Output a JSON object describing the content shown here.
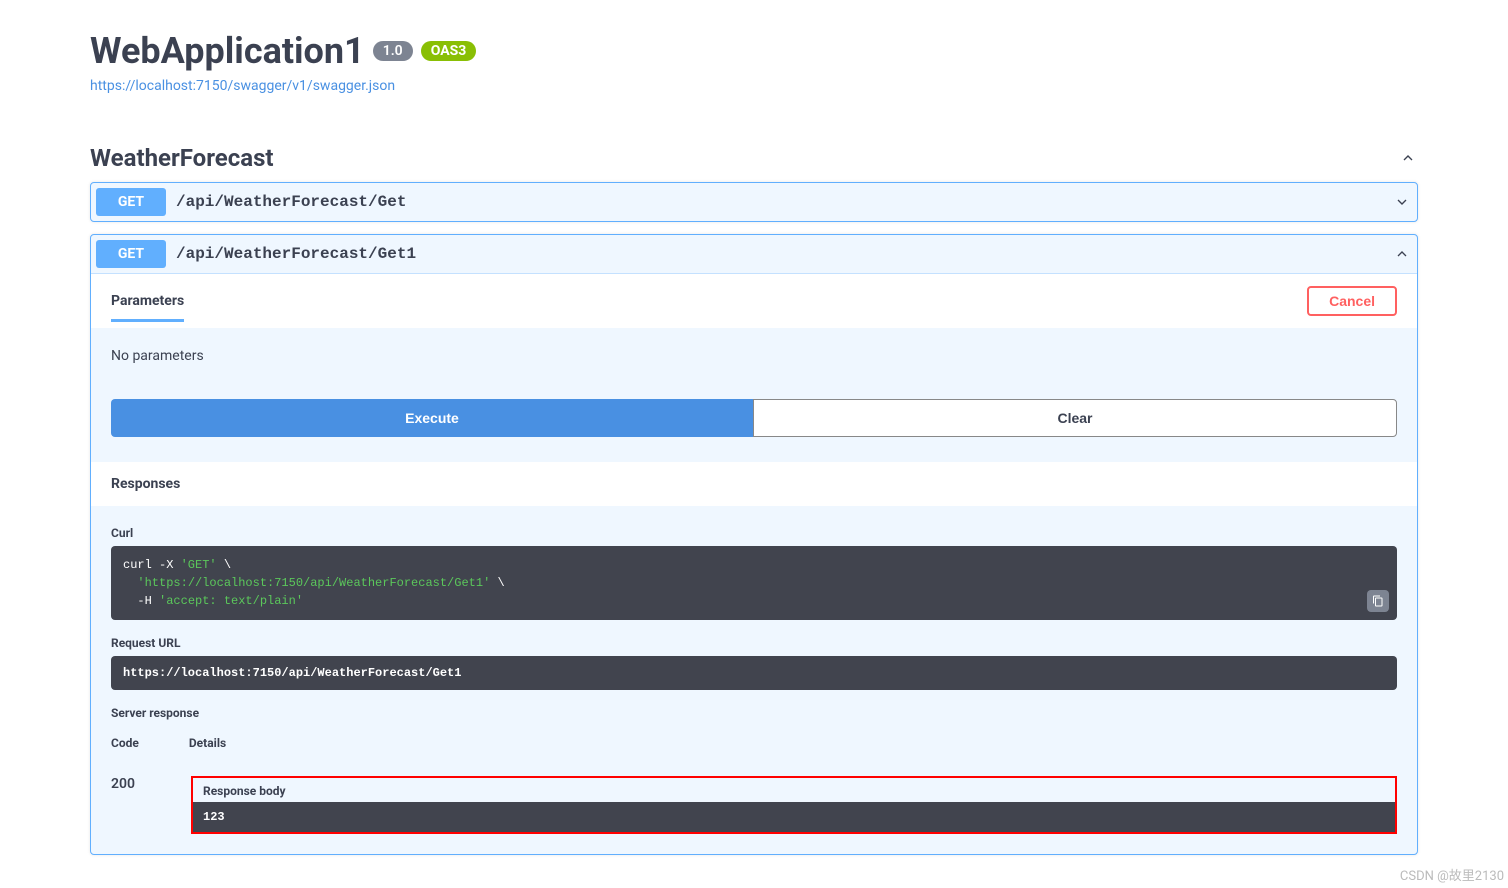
{
  "header": {
    "title": "WebApplication1",
    "version": "1.0",
    "oas": "OAS3",
    "swagger_url": "https://localhost:7150/swagger/v1/swagger.json"
  },
  "tag": {
    "name": "WeatherForecast"
  },
  "endpoints": [
    {
      "method": "GET",
      "path": "/api/WeatherForecast/Get"
    },
    {
      "method": "GET",
      "path": "/api/WeatherForecast/Get1"
    }
  ],
  "parameters": {
    "title": "Parameters",
    "cancel_label": "Cancel",
    "no_params": "No parameters"
  },
  "buttons": {
    "execute": "Execute",
    "clear": "Clear"
  },
  "responses": {
    "title": "Responses",
    "curl_label": "Curl",
    "curl_cmd_1": "curl -X ",
    "curl_cmd_2": "'GET'",
    "curl_cmd_3": " \\",
    "curl_line2a": "  ",
    "curl_line2b": "'https://localhost:7150/api/WeatherForecast/Get1'",
    "curl_line2c": " \\",
    "curl_line3a": "  -H ",
    "curl_line3b": "'accept: text/plain'",
    "request_url_label": "Request URL",
    "request_url": "https://localhost:7150/api/WeatherForecast/Get1",
    "server_response_label": "Server response",
    "code_header": "Code",
    "details_header": "Details",
    "status_code": "200",
    "response_body_label": "Response body",
    "response_body": "123"
  },
  "watermark": "CSDN @故里2130"
}
